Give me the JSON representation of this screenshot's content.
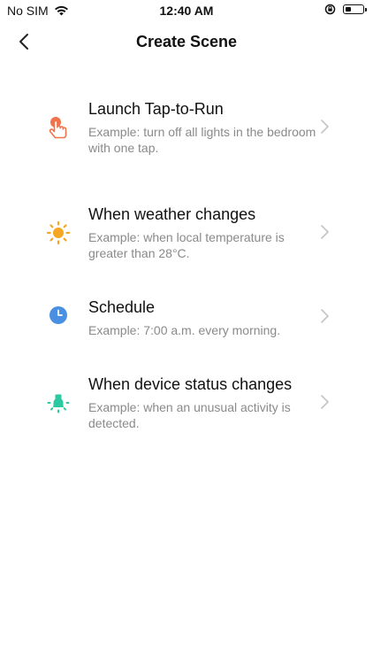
{
  "status_bar": {
    "carrier": "No SIM",
    "time": "12:40 AM"
  },
  "header": {
    "title": "Create Scene"
  },
  "options": [
    {
      "title": "Launch Tap-to-Run",
      "desc": "Example: turn off all lights in the bedroom with one tap.",
      "icon": "tap-hand-icon",
      "color": "#F0734A"
    },
    {
      "title": "When weather changes",
      "desc": "Example: when local temperature is greater than 28°C.",
      "icon": "sun-icon",
      "color": "#F5A623"
    },
    {
      "title": "Schedule",
      "desc": "Example: 7:00 a.m. every morning.",
      "icon": "clock-icon",
      "color": "#4A90E2"
    },
    {
      "title": "When device status changes",
      "desc": "Example: when an unusual activity is detected.",
      "icon": "device-icon",
      "color": "#2BC9A1"
    }
  ]
}
